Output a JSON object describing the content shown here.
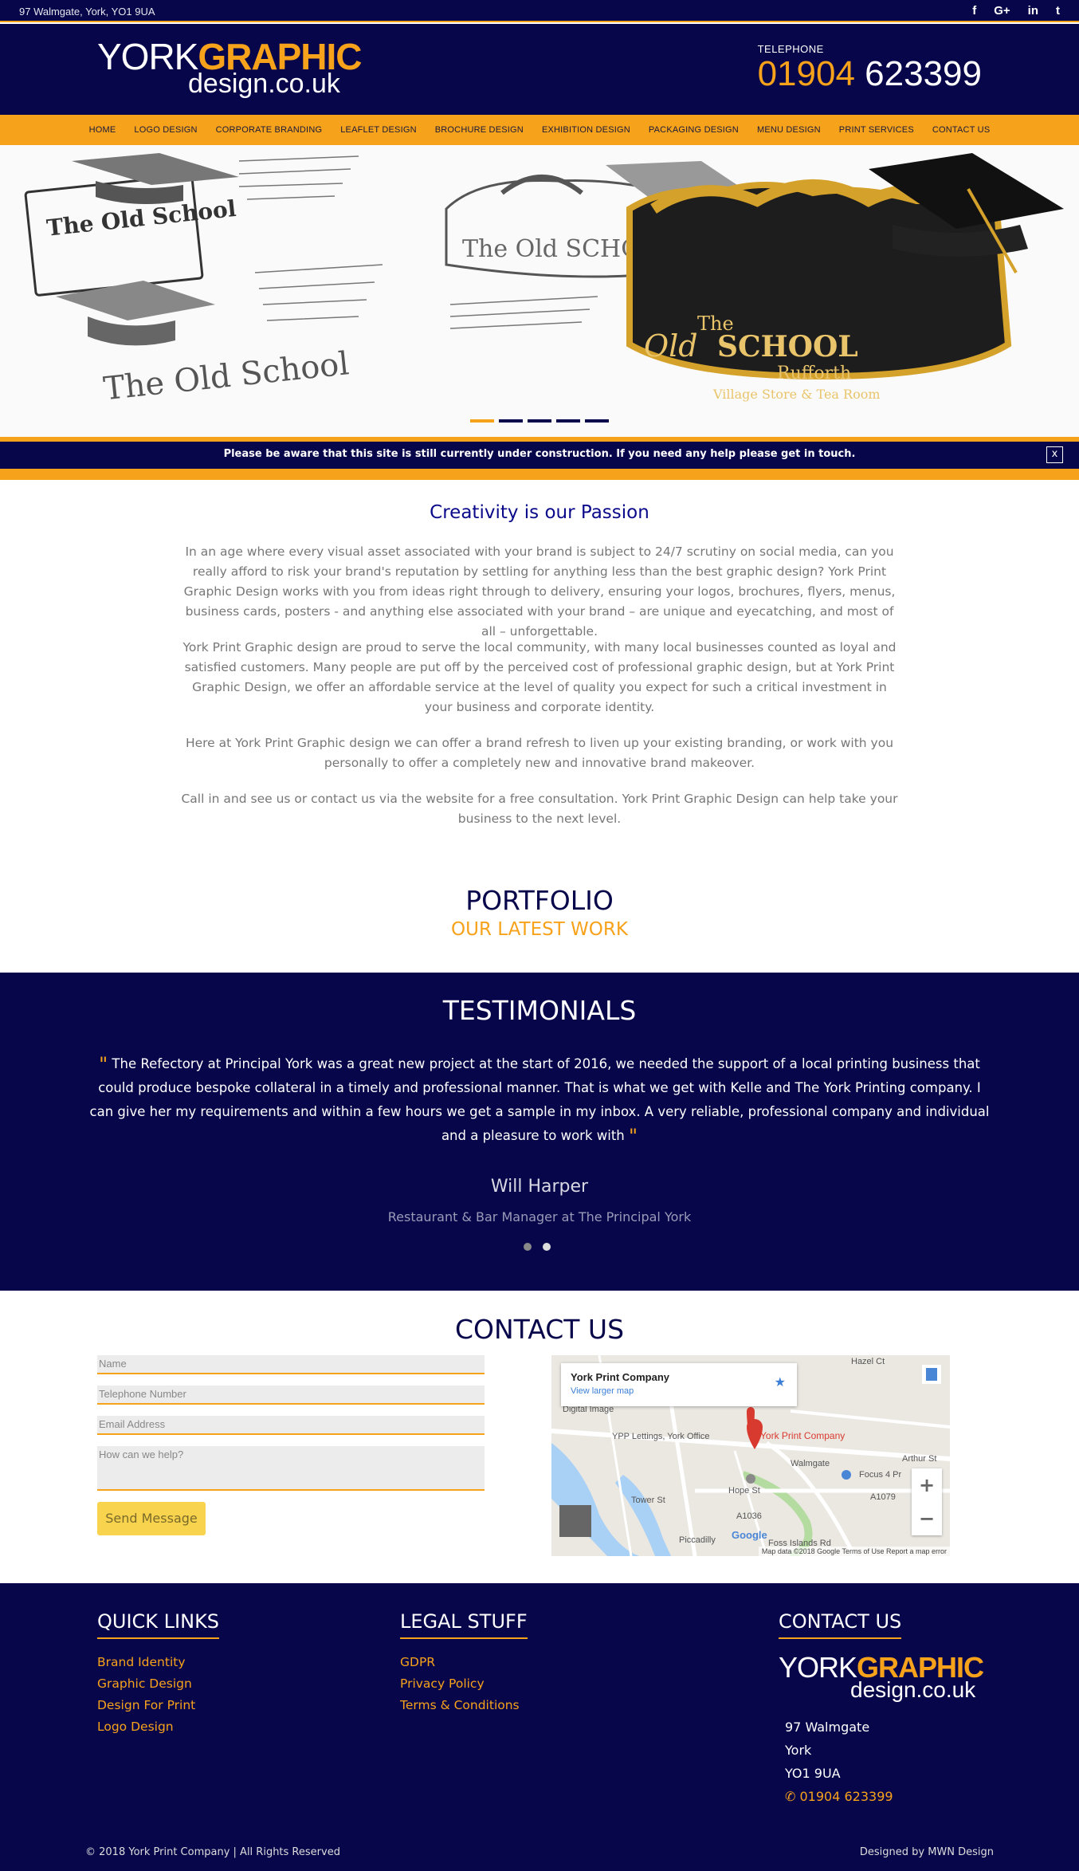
{
  "topbar": {
    "address": "97 Walmgate, York, YO1 9UA",
    "social": [
      {
        "icon": "facebook-icon",
        "glyph": "f"
      },
      {
        "icon": "google-plus-icon",
        "glyph": "G+"
      },
      {
        "icon": "linkedin-icon",
        "glyph": "in"
      },
      {
        "icon": "twitter-icon",
        "glyph": "t"
      }
    ]
  },
  "header": {
    "logo_york": "YORK",
    "logo_graphic": "GRAPHIC",
    "logo_domain": "design.co.uk",
    "phone_label": "TELEPHONE",
    "phone_area": "01904",
    "phone_number": "623399"
  },
  "nav": {
    "items": [
      "HOME",
      "LOGO DESIGN",
      "CORPORATE BRANDING",
      "LEAFLET DESIGN",
      "BROCHURE DESIGN",
      "EXHIBITION DESIGN",
      "PACKAGING DESIGN",
      "MENU DESIGN",
      "PRINT SERVICES",
      "CONTACT US"
    ]
  },
  "hero": {
    "sketch_title_1": "The Old School",
    "sketch_title_2": "The Old School",
    "sketch_title_3": "The Old SCHOOL",
    "final_the": "The",
    "final_old": "Old",
    "final_school": "SCHOOL",
    "final_place": "Rufforth",
    "final_tagline": "Village Store & Tea Room",
    "slide_count": 5,
    "active_slide": 1
  },
  "notice": {
    "text": "Please be aware that this site is still currently under construction. If you need any help please get in touch.",
    "close": "x"
  },
  "intro": {
    "title": "Creativity is our Passion",
    "paragraphs": [
      "In an age where every visual asset associated with your brand is subject to 24/7 scrutiny on social media, can you really afford to risk your brand's reputation by settling for anything less than the best graphic design? York Print Graphic Design works with you from ideas right through to delivery, ensuring your logos, brochures, flyers, menus, business cards, posters - and anything else associated with your brand – are unique and eyecatching, and most of all – unforgettable.",
      "York Print Graphic design are proud to serve the local community, with many local businesses counted as loyal and satisfied customers. Many people are put off by the perceived cost of professional graphic design, but at York Print Graphic Design, we offer an affordable service at the level of quality you expect for such a critical investment in your business and corporate identity.",
      "Here at York Print Graphic design we can offer a brand refresh to liven up your existing branding, or work with you personally to offer a completely new and innovative brand makeover.",
      "Call in and see us or contact us via the website for a free consultation. York Print Graphic Design can help take your business to the next level."
    ]
  },
  "portfolio": {
    "title": "PORTFOLIO",
    "subtitle": "OUR LATEST WORK"
  },
  "testimonials": {
    "title": "TESTIMONIALS",
    "quote": "The Refectory at Principal York was a great new project at the start of 2016, we needed the support of a local printing business that could produce bespoke collateral in a timely and professional manner. That is what we get with Kelle and The York Printing company. I can give her my requirements and within a few hours we get a sample in my inbox. A very reliable, professional company and individual and a pleasure to work with",
    "quote_mark": "\"",
    "name": "Will Harper",
    "role": "Restaurant & Bar Manager at The Principal York"
  },
  "contact": {
    "title": "CONTACT US",
    "name_placeholder": "Name",
    "phone_placeholder": "Telephone Number",
    "email_placeholder": "Email Address",
    "message_placeholder": "How can we help?",
    "send_label": "Send Message",
    "map": {
      "place_name": "York Print Company",
      "larger_map": "View larger map",
      "pin_label": "York Print Company",
      "labels": [
        "YPP Lettings, York Office",
        "Focus 4 Pr",
        "Tower St",
        "Walmgate",
        "A1079",
        "A1036",
        "Hope St",
        "Piccadilly",
        "Foss Islands Rd",
        "Digital Image",
        "Hazel Ct",
        "Arthur St"
      ],
      "zoom_in": "+",
      "zoom_out": "−",
      "attribution": "Map data ©2018 Google   Terms of Use   Report a map error",
      "google": "Google"
    }
  },
  "footer": {
    "quick_title": "QUICK LINKS",
    "quick_links": [
      "Brand Identity",
      "Graphic Design",
      "Design For Print",
      "Logo Design"
    ],
    "legal_title": "LEGAL STUFF",
    "legal_links": [
      "GDPR",
      "Privacy Policy",
      "Terms & Conditions"
    ],
    "contact_title": "CONTACT US",
    "address_lines": [
      "97 Walmgate",
      "York",
      "YO1 9UA"
    ],
    "phone": "01904 623399",
    "copyright": "© 2018 York Print Company | All Rights Reserved",
    "designed_by": "Designed by MWN Design"
  },
  "colors": {
    "navy": "#07064a",
    "orange": "#f7a21b",
    "button_yellow": "#f8d34e",
    "intro_title": "#0a0a8a"
  }
}
